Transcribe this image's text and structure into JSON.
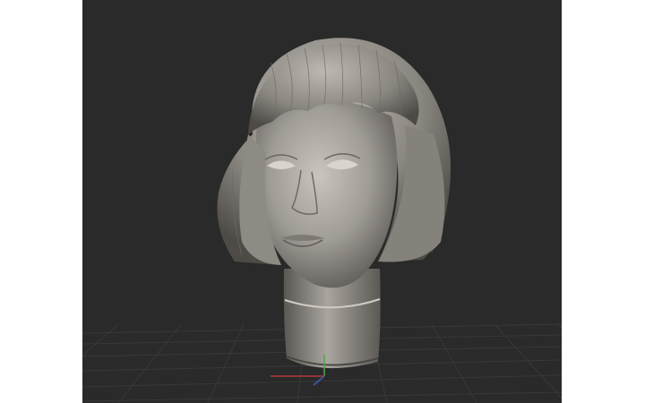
{
  "viewport": {
    "background": "#2a2a2a",
    "grid_color": "#3a3a3a",
    "axis_x_color": "#b23b3b",
    "axis_y_color": "#4aa84a",
    "model": {
      "subject": "sculpted-head-bob-haircut",
      "material_color": "#9a9690"
    }
  }
}
